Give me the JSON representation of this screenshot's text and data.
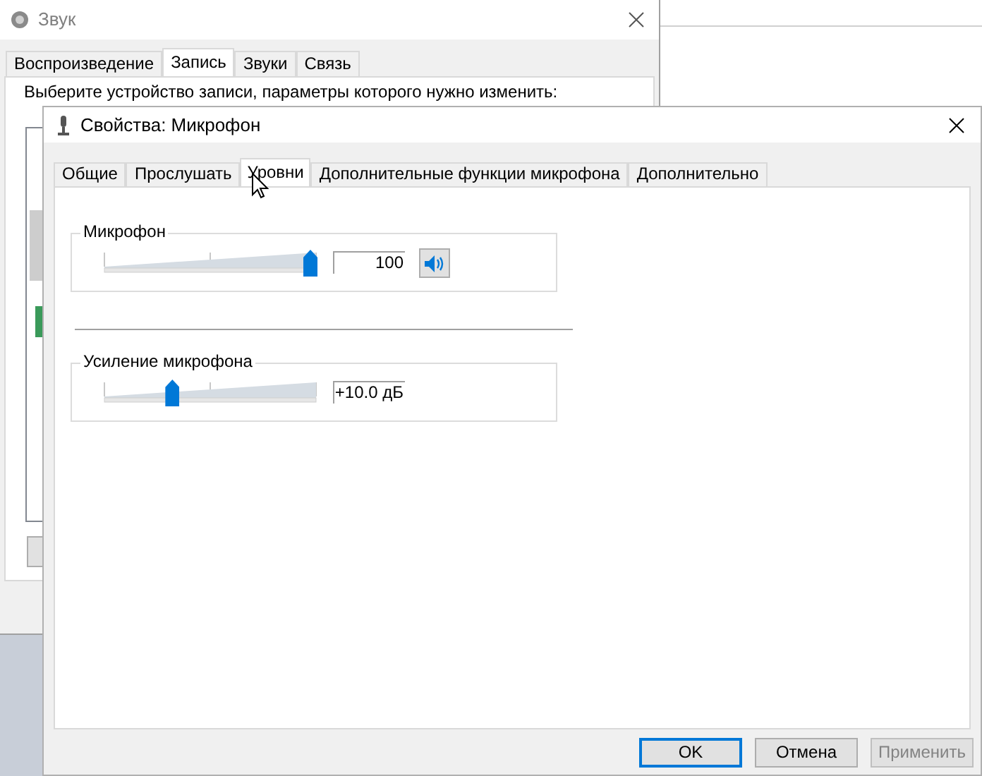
{
  "back_window": {
    "title": "Звук",
    "tabs": [
      {
        "label": "Воспроизведение",
        "selected": false
      },
      {
        "label": "Запись",
        "selected": true
      },
      {
        "label": "Звуки",
        "selected": false
      },
      {
        "label": "Связь",
        "selected": false
      }
    ],
    "prompt": "Выберите устройство записи, параметры которого нужно изменить:"
  },
  "dialog": {
    "title": "Свойства: Микрофон",
    "tabs": [
      {
        "label": "Общие",
        "selected": false
      },
      {
        "label": "Прослушать",
        "selected": false
      },
      {
        "label": "Уровни",
        "selected": true
      },
      {
        "label": "Дополнительные функции микрофона",
        "selected": false
      },
      {
        "label": "Дополнительно",
        "selected": false
      }
    ],
    "levels": [
      {
        "label": "Микрофон",
        "level": 1.0,
        "value": "100",
        "mute_button": true
      },
      {
        "label": "Усиление микрофона",
        "level": 0.33,
        "value": "+10.0 дБ",
        "mute_button": false
      }
    ],
    "buttons": [
      {
        "label": "OK",
        "kind": "default",
        "disabled": false
      },
      {
        "label": "Отмена",
        "kind": "normal",
        "disabled": false
      },
      {
        "label": "Применить",
        "kind": "normal",
        "disabled": true
      }
    ]
  }
}
